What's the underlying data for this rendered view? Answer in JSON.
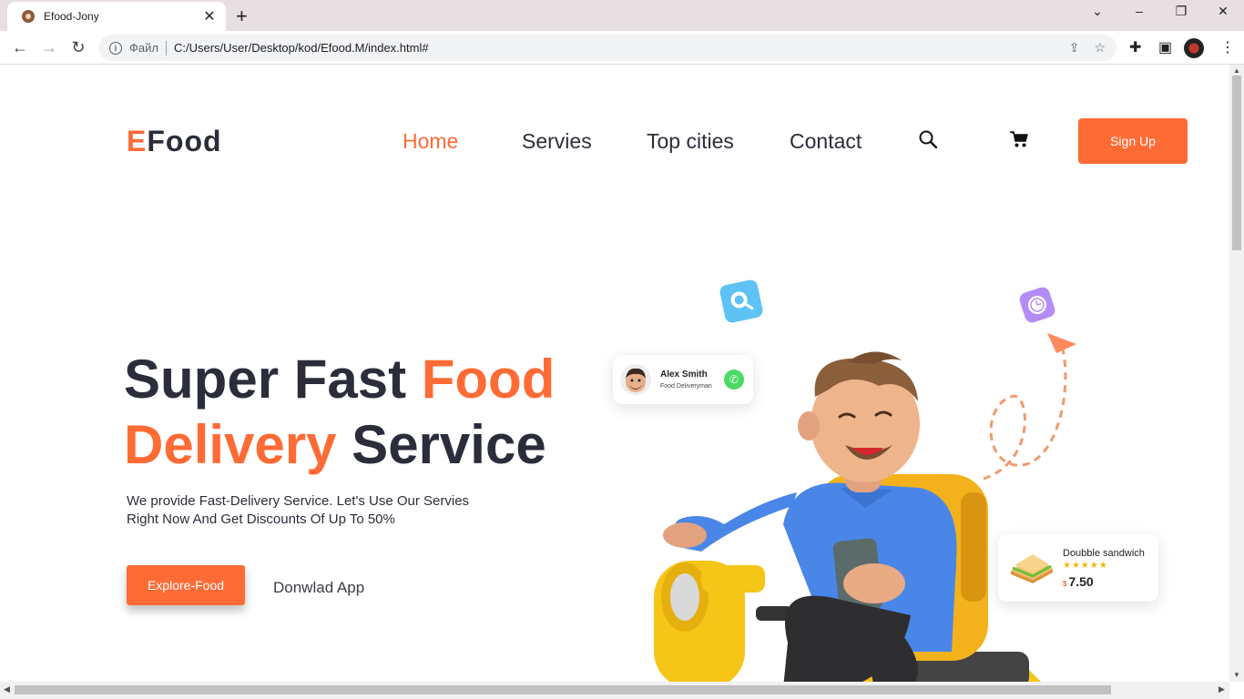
{
  "browser": {
    "tab_title": "Efood-Jony",
    "tab_close": "✕",
    "new_tab": "+",
    "address_prefix": "Файл",
    "address_url": "C:/Users/User/Desktop/kod/Efood.M/index.html#"
  },
  "site": {
    "logo_first": "E",
    "logo_rest": "Food",
    "nav": {
      "home": "Home",
      "services": "Servies",
      "top_cities": "Top cities",
      "contact": "Contact"
    },
    "signup_label": "Sign Up",
    "accent_color": "#ff6b35"
  },
  "hero": {
    "line1_a": "Super Fast ",
    "line1_b": "Food",
    "line2_a": "Delivery",
    "line2_b": " Service",
    "description": "We provide Fast-Delivery Service. Let's Use Our Servies Right Now And Get Discounts Of Up To 50%",
    "explore_label": "Explore-Food",
    "download_label": "Donwlad App"
  },
  "driver_card": {
    "name": "Alex Smith",
    "role": "Food Deliveryman"
  },
  "food_card": {
    "dish_name": "Doubble sandwich",
    "stars": "★★★★★",
    "rating": 4.5,
    "currency": "$",
    "price": "7.50"
  }
}
